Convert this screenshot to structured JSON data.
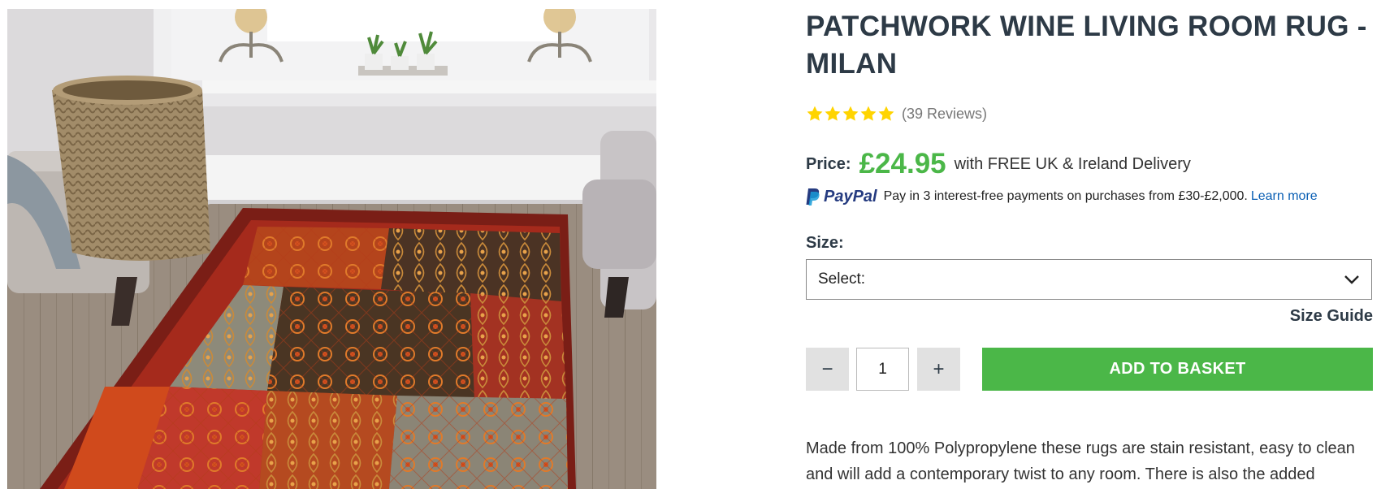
{
  "product": {
    "title": "PATCHWORK WINE LIVING ROOM RUG - MILAN",
    "image_alt": "Patchwork wine living room rug shown in a living room",
    "rating": {
      "stars": 5,
      "max": 5,
      "reviews_label": "(39 Reviews)"
    }
  },
  "pricing": {
    "label": "Price:",
    "value": "£24.95",
    "delivery": "with FREE UK & Ireland Delivery",
    "price_color": "#4bb748"
  },
  "paypal": {
    "wordmark": "PayPal",
    "message": "Pay in 3 interest-free payments on purchases from £30-£2,000.",
    "link_label": "Learn more"
  },
  "size": {
    "label": "Size:",
    "selected": "Select:",
    "guide_label": "Size Guide"
  },
  "quantity": {
    "minus_label": "−",
    "value": "1",
    "plus_label": "+"
  },
  "basket": {
    "button_label": "ADD TO BASKET",
    "color": "#4bb748"
  },
  "description": {
    "text": "Made from 100% Polypropylene these rugs are stain resistant, easy to clean and will add a contemporary twist to any room. There is also the added advantage of"
  },
  "icons": {
    "star": "star-icon",
    "paypal": "paypal-icon",
    "chevron": "chevron-down-icon"
  }
}
